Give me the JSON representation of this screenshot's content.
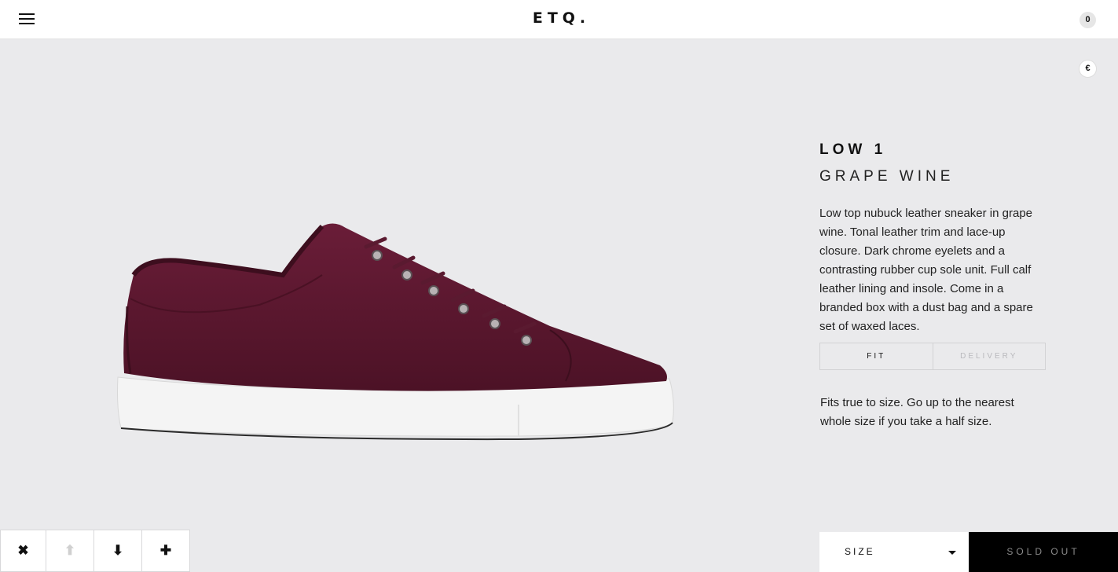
{
  "header": {
    "logo": "ETQ.",
    "cart_count": "0"
  },
  "currency": "€",
  "product": {
    "name": "LOW 1",
    "color": "GRAPE WINE",
    "description": "Low top nubuck leather sneaker in grape wine. Tonal leather trim and lace-up closure. Dark chrome eyelets and a contrasting rubber cup sole unit. Full calf leather lining and insole. Come in a branded box with a dust bag and a spare set of waxed laces."
  },
  "tabs": [
    {
      "label": "FIT",
      "active": true
    },
    {
      "label": "DELIVERY",
      "active": false
    }
  ],
  "fit_text": "Fits true to size. Go up to the nearest whole size if you take a half size.",
  "toolbar": {
    "close": "✖",
    "up": "⬆",
    "down": "⬇",
    "add": "✚"
  },
  "size_select": {
    "label": "SIZE"
  },
  "sold_out_label": "SOLD OUT",
  "colors": {
    "background": "#eaeaec",
    "shoe_upper": "#5e1830",
    "sole": "#f4f4f4"
  }
}
